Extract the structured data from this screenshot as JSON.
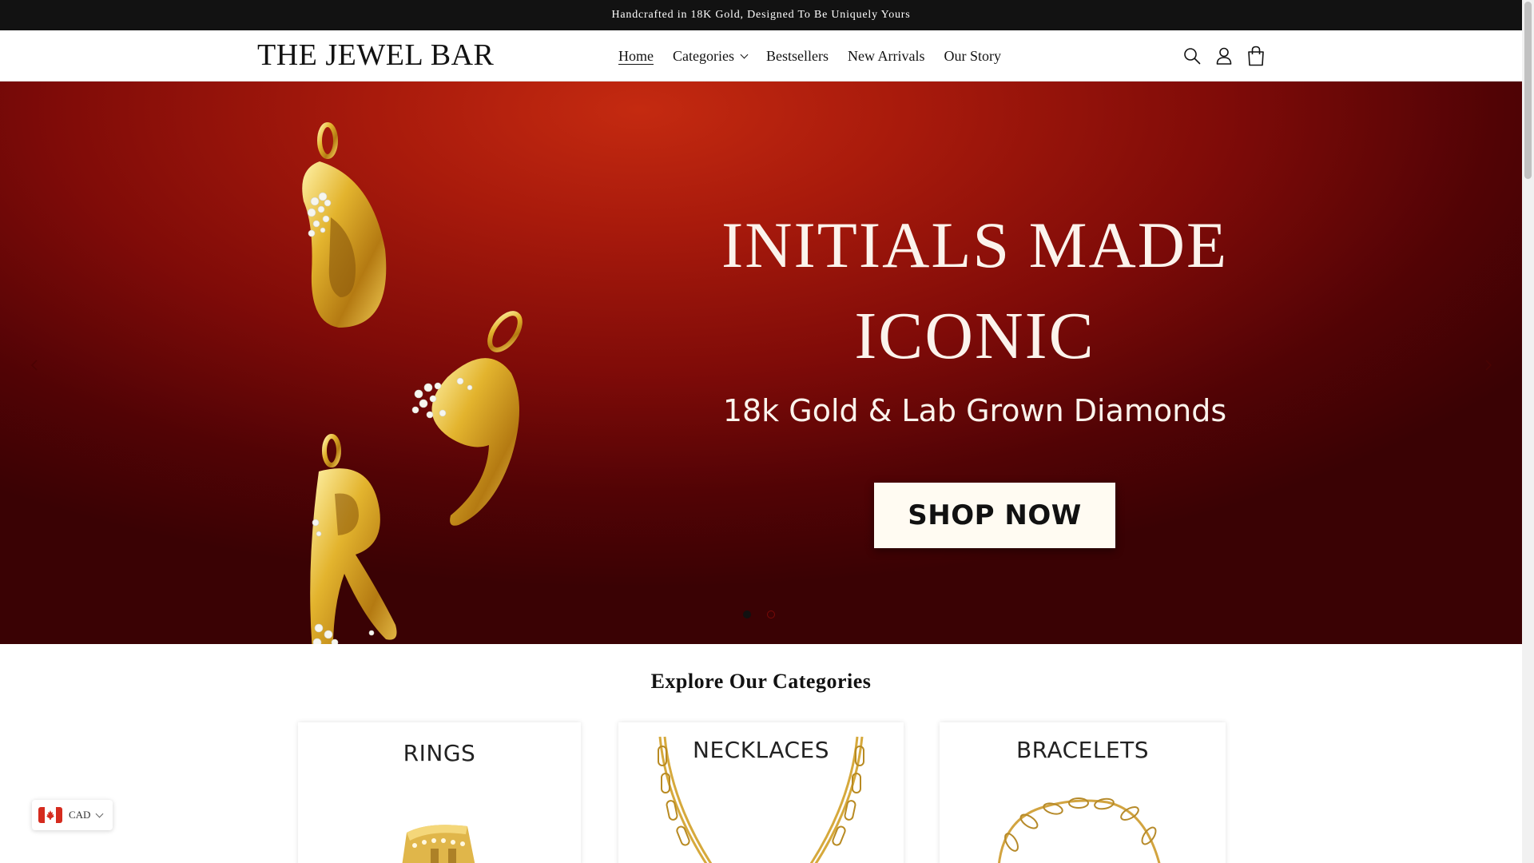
{
  "announcement": {
    "text": "Handcrafted in 18K Gold, Designed To Be Uniquely Yours"
  },
  "header": {
    "logo": "THE JEWEL BAR",
    "nav": [
      {
        "label": "Home",
        "active": true
      },
      {
        "label": "Categories",
        "dropdown": true
      },
      {
        "label": "Bestsellers"
      },
      {
        "label": "New Arrivals"
      },
      {
        "label": "Our Story"
      }
    ],
    "icons": [
      "search-icon",
      "account-icon",
      "cart-icon"
    ]
  },
  "hero": {
    "title_line1": "INITIALS MADE",
    "title_line2": "ICONIC",
    "subtitle": "18k Gold & Lab Grown Diamonds",
    "cta": "SHOP NOW",
    "slides": [
      {
        "active": true
      },
      {
        "active": false
      }
    ],
    "pendant_letters": [
      "D",
      "9",
      "R"
    ],
    "colors": {
      "background": "#8b0d09",
      "text": "#fbf3ec",
      "gold": "#d4a72c"
    }
  },
  "categories": {
    "title": "Explore Our Categories",
    "items": [
      {
        "label": "RINGS"
      },
      {
        "label": "NECKLACES"
      },
      {
        "label": "BRACELETS"
      }
    ]
  },
  "currency": {
    "code": "CAD",
    "flag": "canada-flag-icon"
  }
}
